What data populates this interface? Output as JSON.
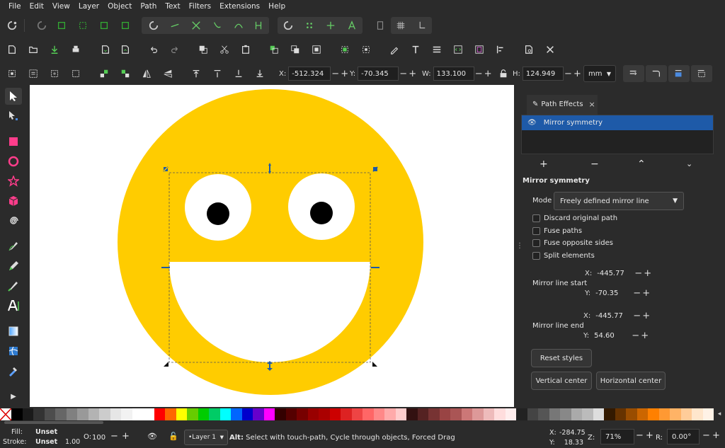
{
  "menu": [
    "File",
    "Edit",
    "View",
    "Layer",
    "Object",
    "Path",
    "Text",
    "Filters",
    "Extensions",
    "Help"
  ],
  "coords": {
    "x_label": "X:",
    "x_value": "-512.324",
    "y_label": "Y:",
    "y_value": "-70.345",
    "w_label": "W:",
    "w_value": "133.100",
    "h_label": "H:",
    "h_value": "124.949",
    "unit": "mm"
  },
  "panel": {
    "tab_label": "Path Effects",
    "effect_item": "Mirror symmetry",
    "section_title": "Mirror symmetry",
    "mode_label": "Mode",
    "mode_value": "Freely defined mirror line",
    "checkboxes": [
      "Discard original path",
      "Fuse paths",
      "Fuse opposite sides",
      "Split elements"
    ],
    "mirror_start_label": "Mirror line start",
    "mirror_start_x": "-445.77",
    "mirror_start_y": "-70.35",
    "mirror_end_label": "Mirror line end",
    "mirror_end_x": "-445.77",
    "mirror_end_y": "54.60",
    "x_lbl": "X:",
    "y_lbl": "Y:",
    "reset_label": "Reset styles",
    "vertical_label": "Vertical center",
    "horizontal_label": "Horizontal center"
  },
  "status": {
    "fill_label": "Fill:",
    "fill_value": "Unset",
    "stroke_label": "Stroke:",
    "stroke_value": "Unset",
    "stroke_width": "1.00",
    "opacity_label": "O:",
    "opacity_value": "100",
    "layer": "•Layer 1",
    "message_bold": "Alt:",
    "message": "Select with touch-path, Cycle through objects, Forced Drag",
    "cursor_x_label": "X:",
    "cursor_x": "-284.75",
    "cursor_y_label": "Y:",
    "cursor_y": "18.33",
    "zoom_label": "Z:",
    "zoom": "71%",
    "rotate_label": "R:",
    "rotate": "0.00°"
  },
  "colors": {
    "face": "#ffcc00",
    "selection_accent": "#1e5aa8",
    "panel_bg": "#2b2b2b"
  },
  "palette": [
    "#000000",
    "#1a1a1a",
    "#333333",
    "#4d4d4d",
    "#666666",
    "#808080",
    "#999999",
    "#b3b3b3",
    "#cccccc",
    "#e6e6e6",
    "#f2f2f2",
    "#ffffff",
    "#ffffff",
    "#ff0000",
    "#ff6600",
    "#ffff00",
    "#66cc00",
    "#00cc00",
    "#00cc66",
    "#00ffff",
    "#0066ff",
    "#0000cc",
    "#6600cc",
    "#ff00ff",
    "#330000",
    "#550000",
    "#770000",
    "#990000",
    "#aa0000",
    "#cc0000",
    "#dd2222",
    "#ee4444",
    "#ff6666",
    "#ff8888",
    "#ffaaaa",
    "#ffcccc",
    "#331111",
    "#552222",
    "#773333",
    "#994444",
    "#aa5555",
    "#cc7777",
    "#dd9999",
    "#eebbbb",
    "#ffdddd",
    "#ffeeee",
    "#222222",
    "#444444",
    "#555555",
    "#777777",
    "#888888",
    "#aaaaaa",
    "#bbbbbb",
    "#dddddd",
    "#331a00",
    "#663300",
    "#994d00",
    "#cc6600",
    "#ff8000",
    "#ff9933",
    "#ffb366",
    "#ffcc99",
    "#ffe6cc",
    "#fff2e6"
  ]
}
